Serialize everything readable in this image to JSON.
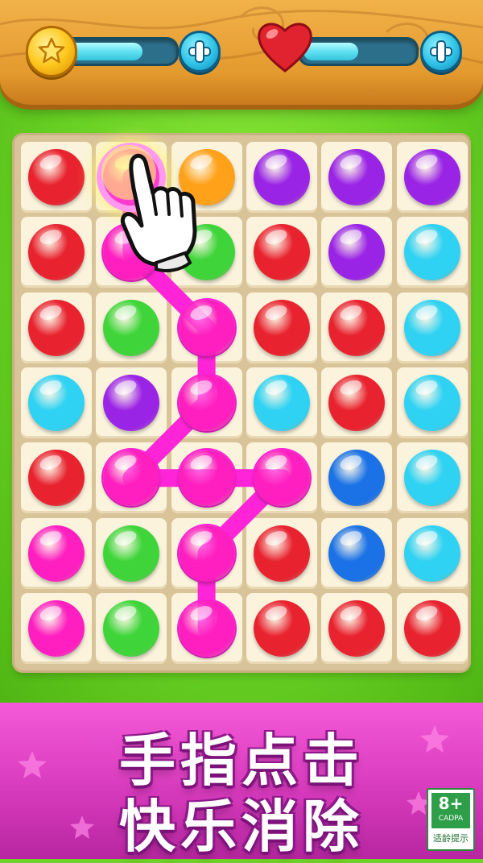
{
  "top_bar": {
    "coin_meter_level": 0.72,
    "lives_meter_level": 0.5,
    "coin_icon": "star-coin-icon",
    "lives_icon": "heart-icon",
    "add_coins_icon": "plus-icon",
    "add_lives_icon": "plus-icon"
  },
  "board": {
    "rows": 7,
    "cols": 6,
    "grid": [
      [
        "red",
        "pink-glow",
        "orange",
        "purple",
        "purple",
        "purple"
      ],
      [
        "red",
        "pink",
        "green",
        "red",
        "purple",
        "cyan"
      ],
      [
        "red",
        "green",
        "pink",
        "red",
        "red",
        "cyan"
      ],
      [
        "cyan",
        "purple",
        "pink",
        "cyan",
        "red",
        "cyan"
      ],
      [
        "red",
        "pink",
        "pink",
        "pink",
        "blue",
        "cyan"
      ],
      [
        "pink",
        "green",
        "pink",
        "red",
        "blue",
        "cyan"
      ],
      [
        "pink",
        "green",
        "pink",
        "red",
        "red",
        "red"
      ]
    ],
    "connected_path": [
      [
        0,
        1
      ],
      [
        1,
        1
      ],
      [
        2,
        2
      ],
      [
        3,
        2
      ],
      [
        4,
        1
      ],
      [
        4,
        2
      ],
      [
        4,
        3
      ],
      [
        5,
        2
      ],
      [
        6,
        2
      ]
    ],
    "colors": {
      "red": "#e8232f",
      "pink": "#ff1fc0",
      "pink-glow": "#ff3bd0",
      "orange": "#ffa21a",
      "purple": "#9a24e6",
      "green": "#3fd53a",
      "cyan": "#2fd2f2",
      "blue": "#1a72e6",
      "path": "#ff24d8"
    },
    "pointer_icon": "pointing-hand-icon"
  },
  "banner": {
    "line1": "手指点击",
    "line2": "快乐消除",
    "rating_number": "8+",
    "rating_org": "CADPA",
    "rating_label": "适龄提示"
  }
}
